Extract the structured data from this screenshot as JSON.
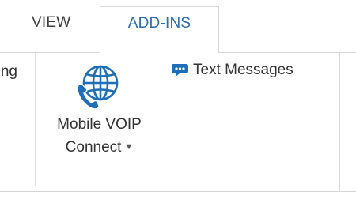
{
  "ribbon": {
    "tabs": [
      {
        "label": "VIEW",
        "selected": false
      },
      {
        "label": "ADD-INS",
        "selected": true
      }
    ],
    "left_group_fragment": "ng"
  },
  "addins_panel": {
    "mobile_voip": {
      "label_line1": "Mobile VOIP",
      "label_line2": "Connect",
      "icon": "globe-phone-icon",
      "has_dropdown": true
    },
    "text_messages": {
      "label": "Text Messages",
      "icon": "chat-bubble-icon"
    }
  },
  "colors": {
    "accent": "#2b6cb3",
    "icon_blue": "#1e6fb8",
    "text": "#333333",
    "border": "#d6d6d6"
  }
}
